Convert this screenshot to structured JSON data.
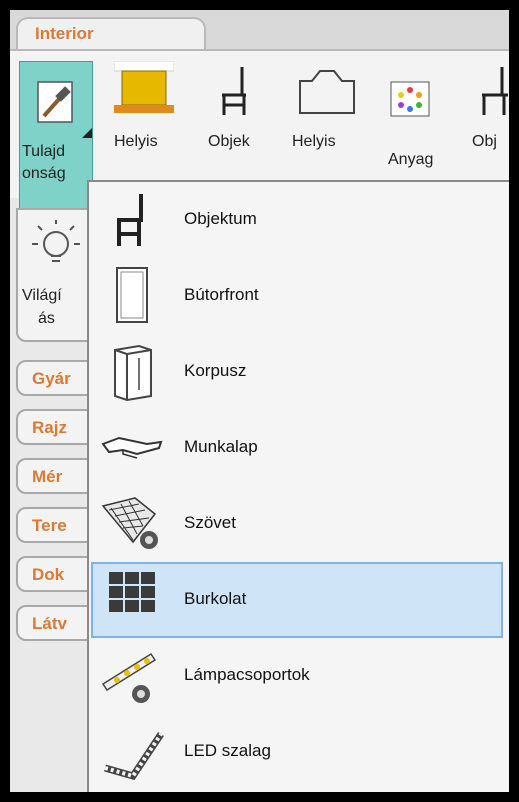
{
  "tab": {
    "label": "Interior"
  },
  "ribbon": {
    "buttons": [
      {
        "line1": "Tulajd",
        "line2": "onság"
      },
      {
        "line1": "Helyis"
      },
      {
        "line1": "Objek"
      },
      {
        "line1": "Helyis"
      },
      {
        "line1": "Anyag"
      },
      {
        "line1": "Obj"
      }
    ]
  },
  "left": {
    "light": {
      "line1": "Világí",
      "line2": "ás"
    },
    "tabs": [
      "Gyár",
      "Rajz",
      "Mér",
      "Tere",
      "Dok",
      "Látv"
    ]
  },
  "menu": {
    "items": [
      {
        "label": "Objektum",
        "icon": "chair-icon"
      },
      {
        "label": "Bútorfront",
        "icon": "furniture-front-icon"
      },
      {
        "label": "Korpusz",
        "icon": "cabinet-icon"
      },
      {
        "label": "Munkalap",
        "icon": "worktop-icon"
      },
      {
        "label": "Szövet",
        "icon": "fabric-mesh-icon"
      },
      {
        "label": "Burkolat",
        "icon": "tile-grid-icon",
        "highlighted": true
      },
      {
        "label": "Lámpacsoportok",
        "icon": "lamp-group-icon"
      },
      {
        "label": "LED szalag",
        "icon": "led-strip-icon"
      }
    ]
  },
  "colors": {
    "accent": "#d97a36",
    "selection": "#7ed2c8",
    "hover": "#cfe4f7",
    "hover_border": "#7eb3e3"
  }
}
